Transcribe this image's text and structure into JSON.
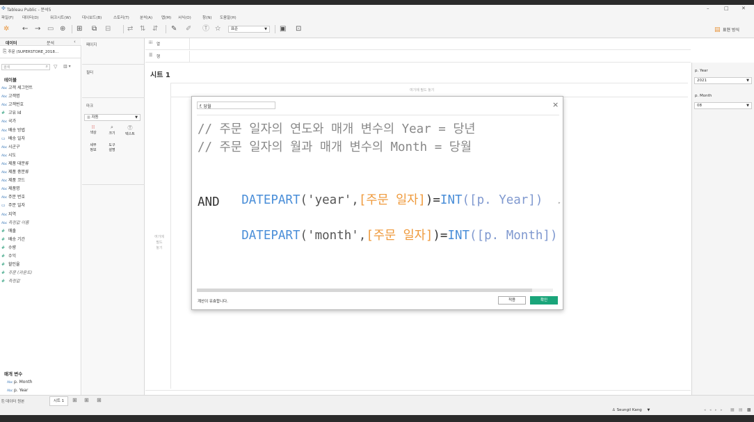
{
  "window": {
    "title": "Tableau Public - 분석5",
    "controls": [
      "–",
      "□",
      "✕"
    ]
  },
  "menu": [
    "파일(F)",
    "데이터(D)",
    "워크시트(W)",
    "대시보드(B)",
    "스토리(T)",
    "분석(A)",
    "맵(M)",
    "서식(O)",
    "창(N)",
    "도움말(H)"
  ],
  "toolbar": {
    "font_size_select": "표준",
    "show_me_label": "표현 방식"
  },
  "data_pane": {
    "tab_data": "데이터",
    "tab_analysis": "분석",
    "datasource": "주문 (SUPERSTORE_2018...",
    "search_placeholder": "검색",
    "tables_header": "테이블",
    "fields": [
      {
        "type": "Abc",
        "name": "고객 세그먼트"
      },
      {
        "type": "Abc",
        "name": "고객명"
      },
      {
        "type": "Abc",
        "name": "고객번호"
      },
      {
        "type": "#",
        "name": "고유 Id"
      },
      {
        "type": "Abc",
        "name": "국가"
      },
      {
        "type": "Abc",
        "name": "배송 방법"
      },
      {
        "type": "date",
        "name": "배송 일자"
      },
      {
        "type": "Abc",
        "name": "시군구"
      },
      {
        "type": "Abc",
        "name": "시도"
      },
      {
        "type": "Abc",
        "name": "제품 대분류"
      },
      {
        "type": "Abc",
        "name": "제품 중분류"
      },
      {
        "type": "Abc",
        "name": "제품 코드"
      },
      {
        "type": "Abc",
        "name": "제품명"
      },
      {
        "type": "Abc",
        "name": "주문 번호"
      },
      {
        "type": "date",
        "name": "주문 일자"
      },
      {
        "type": "Abc",
        "name": "지역"
      },
      {
        "type": "Abc",
        "name": "측정값 이름",
        "italic": true
      },
      {
        "type": "#",
        "name": "매출"
      },
      {
        "type": "#",
        "name": "배송 기간"
      },
      {
        "type": "#",
        "name": "수량"
      },
      {
        "type": "#",
        "name": "수익"
      },
      {
        "type": "#",
        "name": "할인율"
      },
      {
        "type": "#",
        "name": "주문 (카운트)",
        "italic": true
      },
      {
        "type": "#",
        "name": "측정값",
        "italic": true
      }
    ],
    "params_header": "매개 변수",
    "params": [
      {
        "type": "Abc",
        "name": "p. Month"
      },
      {
        "type": "Abc",
        "name": "p. Year"
      }
    ]
  },
  "shelves": {
    "pages": "페이지",
    "filters": "필터",
    "marks": "마크",
    "mark_type": "자동",
    "mark_buttons": [
      "색상",
      "크기",
      "텍스트",
      "세부\n정보",
      "도구\n설명"
    ],
    "columns": "열",
    "rows": "행"
  },
  "sheet": {
    "title": "시트 1",
    "drop_field_top": "여기에 필드 놓기",
    "drop_field_left": "여기에\n필드\n놓기"
  },
  "right_pane": {
    "param1_label": "p. Year",
    "param1_value": "2021",
    "param2_label": "p. Month",
    "param2_value": "08"
  },
  "dialog": {
    "calc_name": "f. 당월",
    "line1": "// 주문 일자의 연도와 매개 변수의 Year = 당년",
    "line2": "// 주문 일자의 월과 매개 변수의 Month = 당월",
    "line3_fn": "DATEPART",
    "line3_str": "('year',",
    "line3_field": "[주문 일자]",
    "line3_rest": ")=",
    "line3_fn2": "INT",
    "line3_param": "([p. Year])",
    "line4": "AND",
    "line5_fn": "DATEPART",
    "line5_str": "('month',",
    "line5_field": "[주문 일자]",
    "line5_rest": ")=",
    "line5_fn2": "INT",
    "line5_param": "([p. Month])",
    "status": "계산이 유효합니다.",
    "apply": "적용",
    "ok": "확인",
    "accent": "#1aa57a"
  },
  "bottom_tabs": {
    "datasource_tab": "데이터 원본",
    "sheet_tab": "시트 1"
  },
  "status": {
    "user": "Seungil Kang"
  }
}
